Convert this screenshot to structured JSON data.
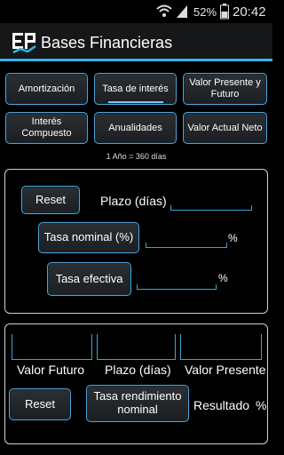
{
  "status": {
    "battery": "52%",
    "time": "20:42"
  },
  "app": {
    "title": "Bases Financieras"
  },
  "nav": {
    "row1": [
      "Amortización",
      "Tasa de interés",
      "Valor Presente y Futuro"
    ],
    "row2": [
      "Interés Compuesto",
      "Anualidades",
      "Valor Actual Neto"
    ]
  },
  "note": "1 Año = 360 días",
  "form1": {
    "reset_label": "Reset",
    "plazo_label": "Plazo (días)",
    "tasa_nominal_label": "Tasa nominal (%)",
    "tasa_efectiva_label": "Tasa efectiva",
    "percent": "%"
  },
  "form2": {
    "col_labels": [
      "Valor Futuro",
      "Plazo (días)",
      "Valor Presente"
    ],
    "reset_label": "Reset",
    "tasa_rend_label": "Tasa rendimiento nominal",
    "resultado_label": "Resultado",
    "percent": "%"
  }
}
